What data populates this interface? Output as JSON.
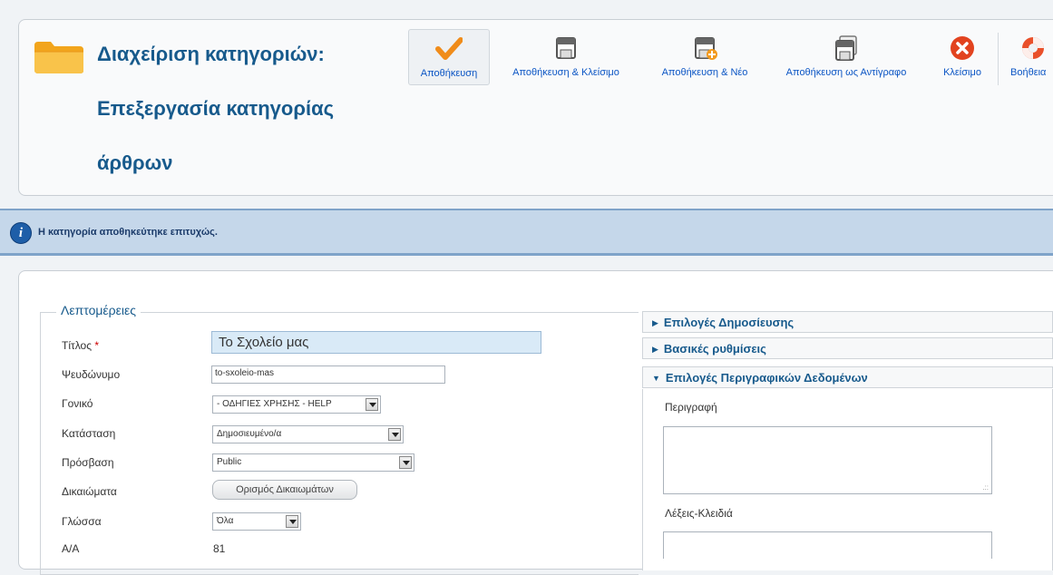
{
  "header": {
    "title_line1": "Διαχείριση κατηγοριών:",
    "title_line2": "Επεξεργασία κατηγορίας",
    "title_line3": "άρθρων"
  },
  "toolbar": {
    "save": "Αποθήκευση",
    "save_close": "Αποθήκευση & Κλείσιμο",
    "save_new": "Αποθήκευση & Νέο",
    "save_copy": "Αποθήκευση ως Αντίγραφο",
    "close": "Κλείσιμο",
    "help": "Βοήθεια"
  },
  "message": "Η κατηγορία αποθηκεύτηκε επιτυχώς.",
  "details": {
    "legend": "Λεπτομέρειες",
    "title_label": "Τίτλος",
    "required_mark": "*",
    "title_value": "Το Σχολείο μας",
    "alias_label": "Ψευδώνυμο",
    "alias_value": "to-sxoleio-mas",
    "parent_label": "Γονικό",
    "parent_value": "- ΟΔΗΓΙΕΣ ΧΡΗΣΗΣ - HELP",
    "status_label": "Κατάσταση",
    "status_value": "Δημοσιευμένο/α",
    "access_label": "Πρόσβαση",
    "access_value": "Public",
    "permissions_label": "Δικαιώματα",
    "permissions_button": "Ορισμός Δικαιωμάτων",
    "language_label": "Γλώσσα",
    "language_value": "Όλα",
    "id_label": "Α/Α",
    "id_value": "81"
  },
  "accordion": {
    "publishing": "Επιλογές Δημοσίευσης",
    "basic": "Βασικές ρυθμίσεις",
    "metadata": "Επιλογές Περιγραφικών Δεδομένων",
    "description_label": "Περιγραφή",
    "keywords_label": "Λέξεις-Κλειδιά"
  },
  "colors": {
    "title_blue": "#175a8c",
    "link_blue": "#0b55c4",
    "message_bg": "#c5d7ea",
    "title_input_bg": "#d9eaf7"
  }
}
